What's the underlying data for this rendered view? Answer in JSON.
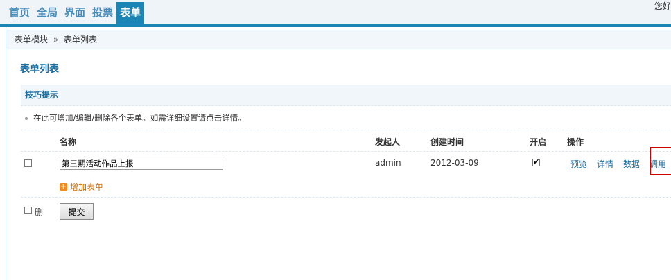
{
  "nav": {
    "items": [
      {
        "label": "首页"
      },
      {
        "label": "全局"
      },
      {
        "label": "界面"
      },
      {
        "label": "投票"
      },
      {
        "label": "表单"
      }
    ],
    "active_index": 4
  },
  "greeting": "您好",
  "breadcrumb": {
    "parent": "表单模块",
    "separator": "»",
    "current": "表单列表"
  },
  "page_title": "表单列表",
  "tips": {
    "title": "技巧提示",
    "text": "在此可增加/编辑/删除各个表单。如需详细设置请点击详情。"
  },
  "table": {
    "headers": {
      "name": "名称",
      "initiator": "发起人",
      "created": "创建时间",
      "enabled": "开启",
      "actions": "操作"
    },
    "rows": [
      {
        "selected": false,
        "name": "第三期活动作品上报",
        "initiator": "admin",
        "created": "2012-03-09",
        "enabled": true,
        "actions": [
          "预览",
          "详情",
          "数据",
          "调用"
        ]
      }
    ]
  },
  "add_button": "增加表单",
  "footer": {
    "delete_label": "删",
    "submit_label": "提交"
  },
  "colors": {
    "accent": "#1b86b6",
    "link": "#1b6fa2",
    "add": "#c8700a",
    "highlight": "#d00000"
  }
}
